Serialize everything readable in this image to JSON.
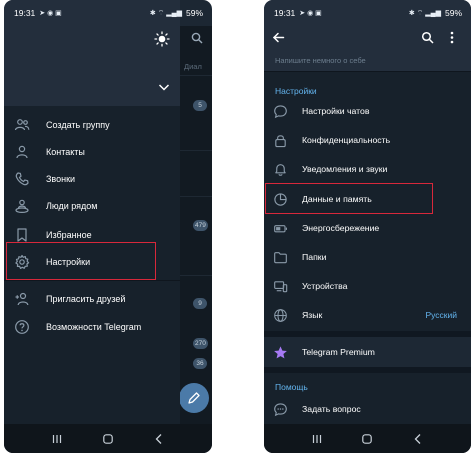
{
  "left_screen": {
    "status": {
      "time": "19:31",
      "battery": "59%"
    },
    "chat_list": {
      "header_text": "Диал",
      "badges": [
        "5",
        "479",
        "9",
        "270",
        "36"
      ]
    },
    "menu": {
      "items": [
        {
          "label": "Создать группу",
          "icon": "two-people-icon"
        },
        {
          "label": "Контакты",
          "icon": "person-icon"
        },
        {
          "label": "Звонки",
          "icon": "phone-icon"
        },
        {
          "label": "Люди рядом",
          "icon": "nearby-people-icon"
        },
        {
          "label": "Избранное",
          "icon": "bookmark-icon"
        },
        {
          "label": "Настройки",
          "icon": "gear-icon"
        },
        {
          "label": "Пригласить друзей",
          "icon": "add-person-icon"
        },
        {
          "label": "Возможности Telegram",
          "icon": "question-circle-icon"
        }
      ]
    }
  },
  "right_screen": {
    "status": {
      "time": "19:31",
      "battery": "59%"
    },
    "bio_placeholder": "Напишите немного о себе",
    "sections": {
      "settings_title": "Настройки",
      "help_title": "Помощь"
    },
    "settings_items": [
      {
        "label": "Настройки чатов",
        "icon": "chat-bubble-icon"
      },
      {
        "label": "Конфиденциальность",
        "icon": "lock-icon"
      },
      {
        "label": "Уведомления и звуки",
        "icon": "bell-icon"
      },
      {
        "label": "Данные и память",
        "icon": "pie-chart-icon"
      },
      {
        "label": "Энергосбережение",
        "icon": "battery-icon"
      },
      {
        "label": "Папки",
        "icon": "folder-icon"
      },
      {
        "label": "Устройства",
        "icon": "devices-icon"
      },
      {
        "label": "Язык",
        "icon": "globe-icon",
        "value": "Русский"
      }
    ],
    "premium": {
      "label": "Telegram Premium",
      "icon": "star-icon"
    },
    "help_items": [
      {
        "label": "Задать вопрос",
        "icon": "question-bubble-icon"
      }
    ]
  },
  "colors": {
    "accent": "#64b5ef",
    "highlight": "#d8283b",
    "background": "#17212b",
    "premium_star": "#a67af4"
  }
}
